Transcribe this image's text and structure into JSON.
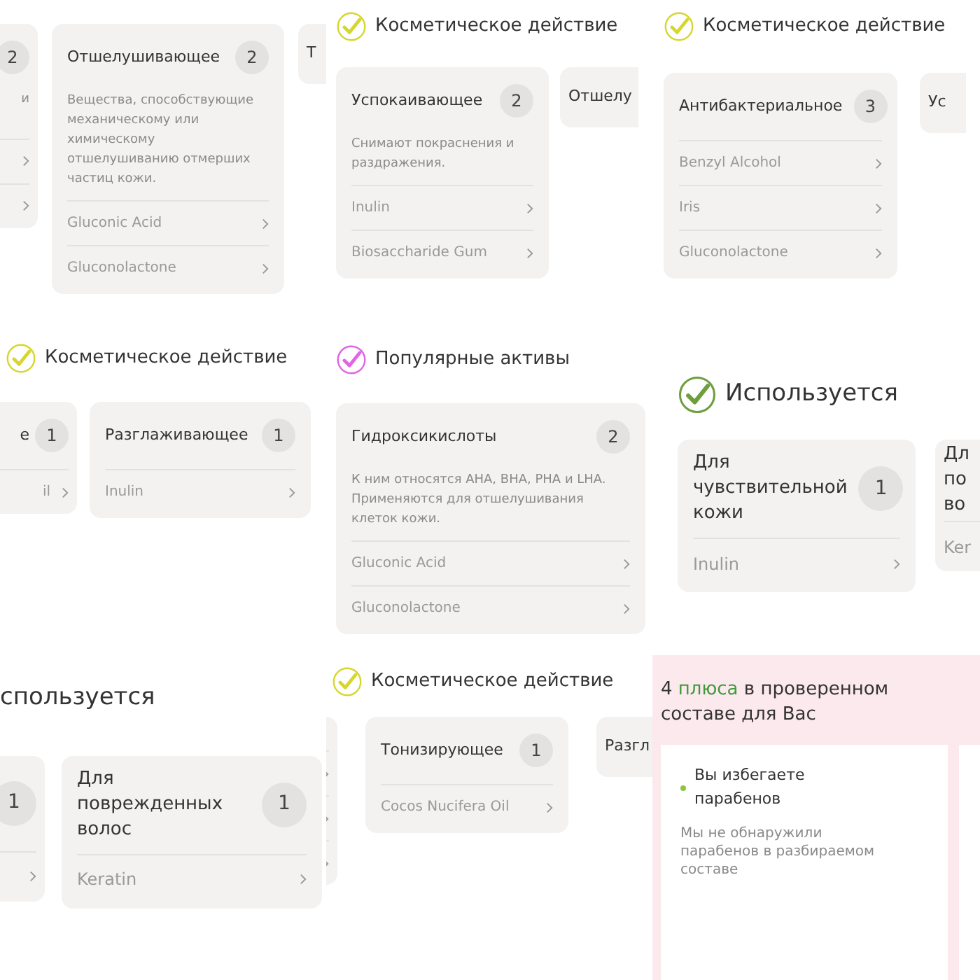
{
  "tiles": [
    {
      "kind": "actions",
      "cards": [
        {
          "kind": "cut_left",
          "count": "2",
          "description": "и",
          "items": [
            {
              "kind": "chevron"
            },
            {
              "kind": "chevron"
            }
          ]
        },
        {
          "kind": "full",
          "title": "Отшелушивающее",
          "count": "2",
          "description": "Вещества, способствующие механическому или химическому отшелушиванию отмерших частиц кожи.",
          "items": [
            {
              "kind": "item",
              "label": "Gluconic Acid"
            },
            {
              "kind": "item",
              "label": "Gluconolactone"
            }
          ]
        },
        {
          "kind": "cut_right",
          "title": "Т"
        }
      ]
    },
    {
      "kind": "actions",
      "header": {
        "title": "Косметическое действие",
        "color": "#d6d62e"
      },
      "cards": [
        {
          "kind": "full",
          "title": "Успокаивающее",
          "count": "2",
          "description": "Снимают покраснения и раздражения.",
          "items": [
            {
              "kind": "item",
              "label": "Inulin"
            },
            {
              "kind": "item",
              "label": "Biosaccharide Gum"
            }
          ]
        },
        {
          "kind": "cut_right",
          "title": "Отшелу"
        }
      ]
    },
    {
      "kind": "actions",
      "header": {
        "title": "Косметическое действие",
        "color": "#d6d62e"
      },
      "cards": [
        {
          "kind": "full",
          "title": "Антибактериальное",
          "count": "3",
          "items": [
            {
              "kind": "item",
              "label": "Benzyl Alcohol"
            },
            {
              "kind": "item",
              "label": "Iris"
            },
            {
              "kind": "item",
              "label": "Gluconolactone"
            }
          ]
        },
        {
          "kind": "cut_right",
          "title": "Ус"
        }
      ]
    },
    {
      "kind": "actions",
      "header": {
        "title": "Косметическое действие",
        "color": "#d6d62e"
      },
      "cards": [
        {
          "kind": "cut_left",
          "title": "е",
          "count": "1",
          "items": [
            {
              "kind": "item",
              "label": "il"
            }
          ]
        },
        {
          "kind": "full",
          "title": "Разглаживающее",
          "count": "1",
          "items": [
            {
              "kind": "item",
              "label": "Inulin"
            }
          ]
        }
      ]
    },
    {
      "kind": "actions",
      "header": {
        "title": "Популярные активы",
        "color": "#e264e6"
      },
      "cards": [
        {
          "kind": "full",
          "title": "Гидроксикислоты",
          "count": "2",
          "description": "К ним относятся AHA, BHA, PHA и LHA. Применяются для отшелушивания клеток кожи.",
          "items": [
            {
              "kind": "item",
              "label": "Gluconic Acid"
            },
            {
              "kind": "item",
              "label": "Gluconolactone"
            }
          ]
        }
      ]
    },
    {
      "kind": "actions",
      "header": {
        "title": "Используется",
        "color": "#6f9e3f"
      },
      "cards": [
        {
          "kind": "full",
          "title": "Для чувствительной кожи",
          "count": "1",
          "items": [
            {
              "kind": "item",
              "label": "Inulin"
            }
          ]
        },
        {
          "kind": "cut_right",
          "title": "Дл по во",
          "items": [
            {
              "kind": "item",
              "label": "Ker"
            }
          ]
        }
      ]
    },
    {
      "kind": "actions",
      "header": {
        "title": "спользуется"
      },
      "cards": [
        {
          "kind": "cut_left",
          "count": "1",
          "items": [
            {
              "kind": "chevron"
            }
          ]
        },
        {
          "kind": "full",
          "title": "Для поврежденных волос",
          "count": "1",
          "items": [
            {
              "kind": "item",
              "label": "Keratin"
            }
          ]
        }
      ]
    },
    {
      "kind": "actions",
      "header": {
        "title": "Косметическое действие",
        "color": "#d6d62e"
      },
      "cards": [
        {
          "kind": "cut_left",
          "items": [
            {
              "kind": "chevron"
            },
            {
              "kind": "chevron"
            },
            {
              "kind": "chevron"
            }
          ]
        },
        {
          "kind": "full",
          "title": "Тонизирующее",
          "count": "1",
          "items": [
            {
              "kind": "item",
              "label": "Cocos Nucifera Oil"
            }
          ]
        },
        {
          "kind": "cut_right",
          "title": "Разгл"
        }
      ]
    },
    {
      "kind": "summary",
      "count": "4",
      "highlight": "плюса",
      "rest": "в проверенном составе для Вас",
      "cards": [
        {
          "color": "#8cc63f",
          "title": "Вы избегаете парабенов",
          "description": "Мы не обнаружили парабенов в разбираемом составе"
        }
      ]
    }
  ]
}
